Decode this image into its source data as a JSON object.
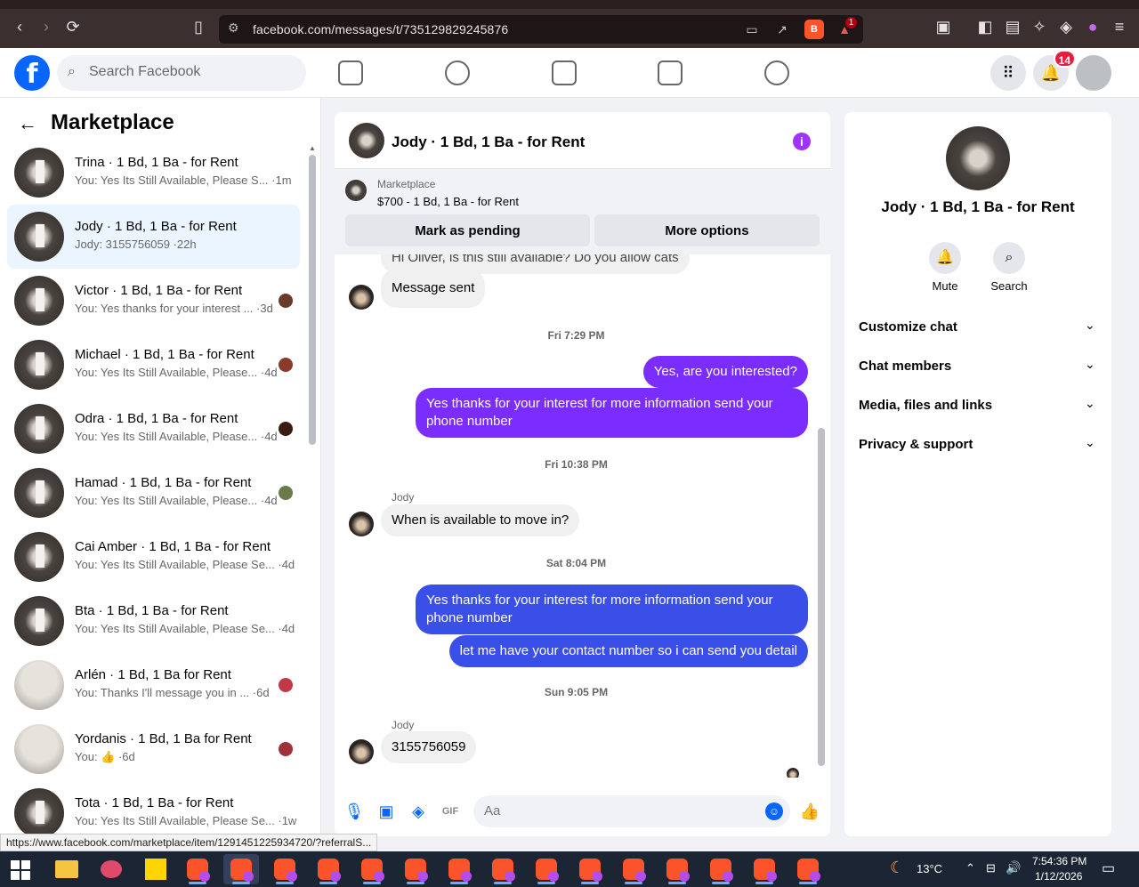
{
  "browser": {
    "url": "facebook.com/messages/t/735129829245876",
    "status_url": "https://www.facebook.com/marketplace/item/1291451225934720/?referralS...",
    "bat_badge": "1"
  },
  "fb_nav": {
    "logo": "f",
    "search_placeholder": "Search Facebook",
    "notification_count": "14"
  },
  "sidebar": {
    "title": "Marketplace",
    "conversations": [
      {
        "name": "Trina · 1 Bd, 1 Ba - for Rent",
        "snippet": "You: Yes Its Still Available, Please S... ·1m"
      },
      {
        "name": "Jody · 1 Bd, 1 Ba - for Rent",
        "snippet": "Jody: 3155756059 ·22h"
      },
      {
        "name": "Victor · 1 Bd, 1 Ba - for Rent",
        "snippet": "You: Yes thanks for your interest ... ·3d"
      },
      {
        "name": "Michael · 1 Bd, 1 Ba - for Rent",
        "snippet": "You: Yes Its Still Available, Please... ·4d"
      },
      {
        "name": "Odra · 1 Bd, 1 Ba - for Rent",
        "snippet": "You: Yes Its Still Available, Please... ·4d"
      },
      {
        "name": "Hamad · 1 Bd, 1 Ba - for Rent",
        "snippet": "You: Yes Its Still Available, Please... ·4d"
      },
      {
        "name": "Cai Amber · 1 Bd, 1 Ba - for Rent",
        "snippet": "You: Yes Its Still Available, Please Se... ·4d"
      },
      {
        "name": "Bta · 1 Bd, 1 Ba - for Rent",
        "snippet": "You: Yes Its Still Available, Please Se... ·4d"
      },
      {
        "name": "Arlén · 1 Bd, 1 Ba for Rent",
        "snippet": "You: Thanks I'll message you in ... ·6d"
      },
      {
        "name": "Yordanis · 1 Bd, 1 Ba for Rent",
        "snippet": "You: 👍 ·6d"
      },
      {
        "name": "Tota · 1 Bd, 1 Ba - for Rent",
        "snippet": "You: Yes Its Still Available, Please Se... ·1w"
      }
    ]
  },
  "chat": {
    "title": "Jody · 1 Bd, 1 Ba - for Rent",
    "marketplace_label": "Marketplace",
    "listing": "$700 - 1 Bd, 1 Ba - for Rent",
    "mark_pending": "Mark as pending",
    "more_options": "More options",
    "messages": {
      "partial_top": "Hi Oliver, is this still available? Do you allow cats",
      "message_sent": "Message sent",
      "ts1": "Fri 7:29 PM",
      "out1": "Yes, are you interested?",
      "out2": "Yes thanks for your interest for more information send your phone number",
      "ts2": "Fri 10:38 PM",
      "sender1": "Jody",
      "in1": "When is available to move in?",
      "ts3": "Sat 8:04 PM",
      "out3": "Yes thanks for your interest for more information send your phone number",
      "out4": "let me have your contact number so i can send you detail",
      "ts4": "Sun 9:05 PM",
      "sender2": "Jody",
      "in2": "3155756059"
    },
    "composer_placeholder": "Aa"
  },
  "info_panel": {
    "name": "Jody · 1 Bd, 1 Ba - for Rent",
    "mute": "Mute",
    "search": "Search",
    "sections": [
      "Customize chat",
      "Chat members",
      "Media, files and links",
      "Privacy & support"
    ]
  },
  "taskbar": {
    "weather": "13°C",
    "time": "7:54:36 PM",
    "date": "1/12/2026"
  },
  "colors": {
    "accent_blue": "#0866ff",
    "bubble_purple": "#7b2cff",
    "bubble_blue": "#3a4fe8"
  }
}
